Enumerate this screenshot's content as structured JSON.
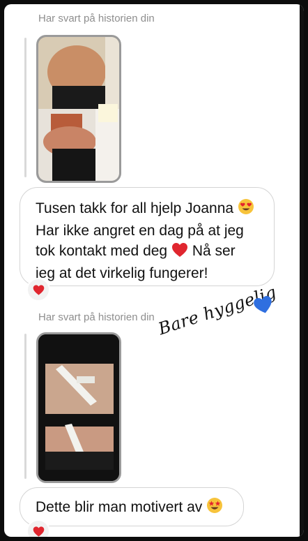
{
  "thread": {
    "reply_label_1": "Har svart på historien din",
    "reply_label_2": "Har svart på historien din"
  },
  "messages": {
    "message_1": {
      "line1": "Tusen takk for all hjelp Joanna",
      "line2": "Har ikke angret en dag på at jeg",
      "line3": "tok kontakt med deg",
      "line3b": " Nå ser",
      "line4": "jeg at det virkelig fungerer!"
    },
    "message_2": {
      "text": "Dette blir man motivert av"
    }
  },
  "sticker": {
    "text": "Bare hyggelig"
  },
  "icons": {
    "heart_reaction": "heart-icon",
    "heart_eyes": "heart-eyes-emoji",
    "red_heart": "red-heart-emoji",
    "star_struck": "star-struck-emoji",
    "blue_heart": "blue-heart-emoji"
  },
  "colors": {
    "heart_red": "#e0262f",
    "blue_heart": "#2f6fe0",
    "label_gray": "#8e8e8e"
  }
}
